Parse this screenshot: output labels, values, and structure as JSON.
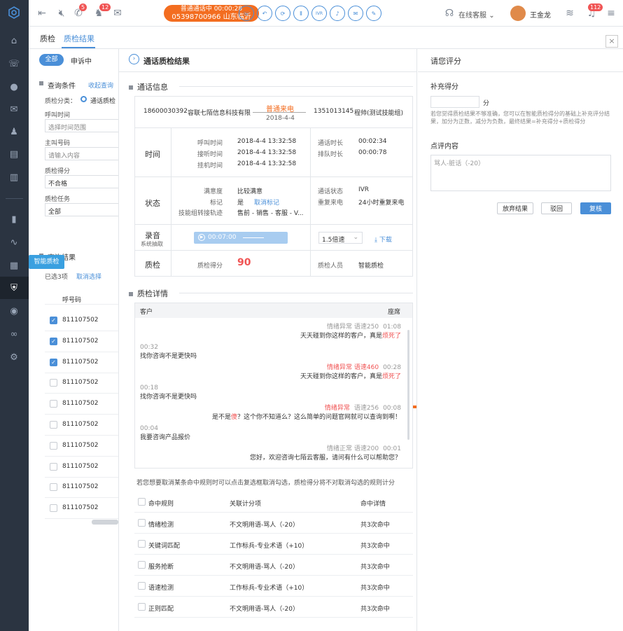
{
  "topbar": {
    "badge_chat": "5",
    "badge_contacts": "12",
    "call_status": "普通通话中 00:00:28",
    "call_number": "05398700966 山东临沂",
    "controls": [
      "☏",
      "↶",
      "⟳",
      "Ⅱ",
      "IVR",
      "♪",
      "✉",
      "✎"
    ],
    "service_status": "在线客服",
    "user_name": "王金龙",
    "bell_badge": "112"
  },
  "tabs": {
    "tab1": "质检",
    "tab2": "质检结果"
  },
  "left": {
    "filter_all": "全部",
    "filter_appeal": "申诉中",
    "query_title": "查询条件",
    "collapse": "收起查询",
    "category_label": "质检分类：",
    "category_value": "通话质检",
    "call_time_label": "呼叫时间",
    "call_time_placeholder": "选择时间范围",
    "caller_label": "主叫号码",
    "caller_placeholder": "请输入内容",
    "score_label": "质检得分",
    "score_value": "不合格",
    "task_label": "质检任务",
    "task_value": "全部",
    "result_title": "查询结果",
    "selected_text": "已选3项",
    "cancel_select": "取消选择",
    "col_header": "呼号码",
    "rows": [
      {
        "num": "811107502",
        "checked": true
      },
      {
        "num": "811107502",
        "checked": true
      },
      {
        "num": "811107502",
        "checked": true
      },
      {
        "num": "811107502",
        "checked": false
      },
      {
        "num": "811107502",
        "checked": false
      },
      {
        "num": "811107502",
        "checked": false
      },
      {
        "num": "811107502",
        "checked": false
      },
      {
        "num": "811107502",
        "checked": false
      },
      {
        "num": "811107502",
        "checked": false
      },
      {
        "num": "811107502",
        "checked": false
      }
    ]
  },
  "tooltip": "智能质检",
  "mid": {
    "title": "通话质检结果",
    "section_info": "通话信息",
    "from_number": "18600030392",
    "from_company": "容联七陌信息科技有限",
    "call_type": "普通来电",
    "call_date": "2018-4-4",
    "to_number": "1351013145",
    "to_agent": "程帅(测试技能组)",
    "time_label": "时间",
    "call_time_k": "呼叫时间",
    "call_time_v": "2018-4-4 13:32:58",
    "answer_k": "接听时间",
    "answer_v": "2018-4-4 13:32:58",
    "hangup_k": "挂机时间",
    "hangup_v": "2018-4-4 13:32:58",
    "duration_k": "通话时长",
    "duration_v": "00:02:34",
    "queue_k": "排队时长",
    "queue_v": "00:00:78",
    "status_label": "状态",
    "satisfaction_k": "满意度",
    "satisfaction_v": "比较满意",
    "mark_k": "标记",
    "mark_v": "是",
    "mark_cancel": "取消标记",
    "transfer_k": "技能组转接轨迹",
    "transfer_v": "售前 - 销售 - 客服 - V...",
    "callstate_k": "通话状态",
    "callstate_v": "IVR",
    "repeat_k": "重复来电",
    "repeat_v": "24小时重复来电",
    "record_label": "录音",
    "record_sub": "系统抽取",
    "audio_time": "00:07:00",
    "speed": "1.5倍速",
    "download": "下载",
    "qc_label": "质检",
    "qc_score_k": "质检得分",
    "qc_score_v": "90",
    "qc_person_k": "质检人员",
    "qc_person_v": "智能质检",
    "section_detail": "质检详情",
    "col_customer": "客户",
    "col_agent": "座席",
    "messages": [
      {
        "side": "agent",
        "meta": "情绪异常  语速250",
        "time": "01:08",
        "text": "天天碰到你这样的客户，真是",
        "hl": "烦死了",
        "tail": "",
        "alert": false
      },
      {
        "side": "cust",
        "time": "00:32",
        "text": "找你咨询不是更快吗"
      },
      {
        "side": "agent",
        "meta": "情绪异常  语速460",
        "time": "00:28",
        "text": "天天碰到你这样的客户，真是",
        "hl": "烦死了",
        "tail": "",
        "alert": true
      },
      {
        "side": "cust",
        "time": "00:18",
        "text": "找你咨询不是更快吗"
      },
      {
        "side": "agent",
        "meta": "情绪异常",
        "meta2": "语速256",
        "time": "00:08",
        "text": "是不是",
        "hl": "傻",
        "tail": "？这个你不知道么？这么简单的问题官网就可以查询到啊！",
        "alert": "partial"
      },
      {
        "side": "cust",
        "time": "00:04",
        "text": "我要咨询产品报价"
      },
      {
        "side": "agent",
        "meta": "情绪正常  语速200",
        "time": "00:01",
        "text": "您好，欢迎咨询七陌云客服，请问有什么可以帮助您？",
        "hl": "",
        "tail": "",
        "alert": false
      }
    ],
    "hint": "若您想要取消某条命中规则时可以点击复选框取消勾选，质检得分将不对取消勾选的规则计分",
    "rule_cols": [
      "命中规则",
      "关联计分项",
      "命中详情"
    ],
    "rules": [
      {
        "name": "情绪检测",
        "item": "不文明用语-骂人（-20）",
        "detail": "共3次命中"
      },
      {
        "name": "关键词匹配",
        "item": "工作标兵-专业术语（+10）",
        "detail": "共3次命中"
      },
      {
        "name": "服务抢断",
        "item": "不文明用语-骂人（-20）",
        "detail": "共3次命中"
      },
      {
        "name": "语速检测",
        "item": "工作标兵-专业术语（+10）",
        "detail": "共3次命中"
      },
      {
        "name": "正则匹配",
        "item": "不文明用语-骂人（-20）",
        "detail": "共3次命中"
      }
    ]
  },
  "right": {
    "title": "请您评分",
    "supp_title": "补充得分",
    "supp_unit": "分",
    "supp_hint": "若您觉得质检结果不够准确，您可以在智能质检得分的基础上补充评分结果，加分为正数，减分为负数，最终结果=补充得分+质检得分",
    "comment_title": "点评内容",
    "comment_placeholder": "骂人-脏话（-20）",
    "btn_abandon": "放弃结果",
    "btn_reject": "驳回",
    "btn_review": "复核"
  }
}
